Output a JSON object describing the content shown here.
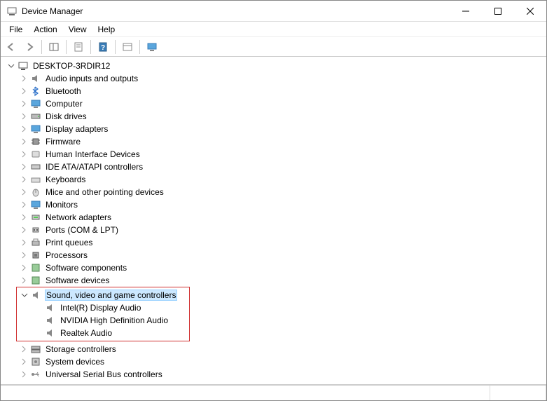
{
  "window": {
    "title": "Device Manager"
  },
  "menu": {
    "file": "File",
    "action": "Action",
    "view": "View",
    "help": "Help"
  },
  "root": {
    "name": "DESKTOP-3RDIR12"
  },
  "categories": [
    {
      "label": "Audio inputs and outputs",
      "icon": "speaker"
    },
    {
      "label": "Bluetooth",
      "icon": "bluetooth"
    },
    {
      "label": "Computer",
      "icon": "monitor"
    },
    {
      "label": "Disk drives",
      "icon": "disk"
    },
    {
      "label": "Display adapters",
      "icon": "monitor"
    },
    {
      "label": "Firmware",
      "icon": "chip"
    },
    {
      "label": "Human Interface Devices",
      "icon": "hid"
    },
    {
      "label": "IDE ATA/ATAPI controllers",
      "icon": "ide"
    },
    {
      "label": "Keyboards",
      "icon": "keyboard"
    },
    {
      "label": "Mice and other pointing devices",
      "icon": "mouse"
    },
    {
      "label": "Monitors",
      "icon": "monitor"
    },
    {
      "label": "Network adapters",
      "icon": "network"
    },
    {
      "label": "Ports (COM & LPT)",
      "icon": "port"
    },
    {
      "label": "Print queues",
      "icon": "printer"
    },
    {
      "label": "Processors",
      "icon": "cpu"
    },
    {
      "label": "Software components",
      "icon": "software"
    },
    {
      "label": "Software devices",
      "icon": "software"
    }
  ],
  "expanded_category": {
    "label": "Sound, video and game controllers",
    "icon": "speaker",
    "children": [
      {
        "label": "Intel(R) Display Audio"
      },
      {
        "label": "NVIDIA High Definition Audio"
      },
      {
        "label": "Realtek Audio"
      }
    ]
  },
  "categories_after": [
    {
      "label": "Storage controllers",
      "icon": "storage"
    },
    {
      "label": "System devices",
      "icon": "system"
    },
    {
      "label": "Universal Serial Bus controllers",
      "icon": "usb"
    }
  ]
}
